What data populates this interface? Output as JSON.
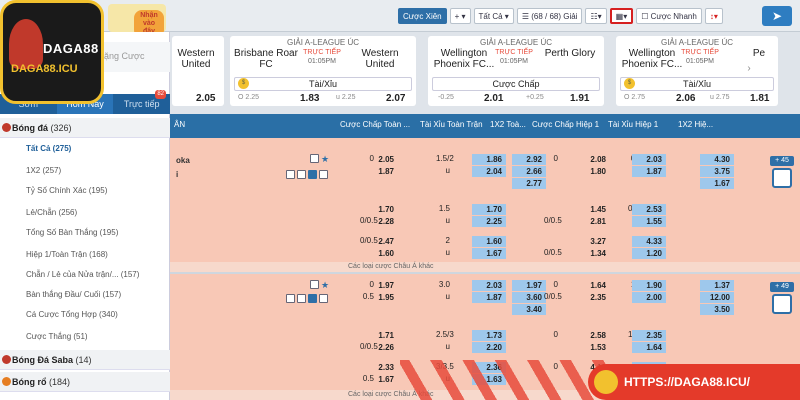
{
  "logo": {
    "text1": "DAGA88",
    "text2": "DAGA88.ICU"
  },
  "promo": {
    "badge": "Nhận vào đây"
  },
  "toolbar": {
    "parlay": "Cược Xiên",
    "all": "Tất Cả",
    "games": "(68 / 68) Giải",
    "quick": "Cược Nhanh"
  },
  "sidebar": {
    "search_placeholder": "ặng Cược",
    "tabs": [
      {
        "label": "Sớm"
      },
      {
        "label": "Hôm Nay"
      },
      {
        "label": "Trực tiếp",
        "badge": "82"
      }
    ],
    "sports": [
      {
        "label": "Bóng đá",
        "count": "(326)"
      },
      {
        "label": "Bóng Đá Saba",
        "count": "(14)"
      },
      {
        "label": "Bóng rổ",
        "count": "(184)"
      }
    ],
    "items": [
      {
        "label": "Tất Cả (275)"
      },
      {
        "label": "1X2 (257)"
      },
      {
        "label": "Tỷ Số Chính Xác (195)"
      },
      {
        "label": "Lẻ/Chẵn (256)"
      },
      {
        "label": "Tổng Số Bàn Thắng (195)"
      },
      {
        "label": "Hiệp 1/Toàn Trận (168)"
      },
      {
        "label": "Chẵn / Lẻ của Nửa trận/... (157)"
      },
      {
        "label": "Bàn thắng Đầu/ Cuối (157)"
      },
      {
        "label": "Cá Cược Tổng Hợp (340)"
      },
      {
        "label": "Cược Thắng (51)"
      }
    ]
  },
  "cards": [
    {
      "league": "",
      "home": "",
      "away": "Western United",
      "live": "",
      "time": "",
      "market": "",
      "ol": "",
      "ov1": "",
      "or": "",
      "ov2": "2.05"
    },
    {
      "league": "GIẢI A-LEAGUE ÚC",
      "home": "Brisbane Roar FC",
      "away": "Western United",
      "live": "TRỰC TIẾP",
      "time": "01:05PM",
      "market": "Tài/Xỉu",
      "ol": "O 2.25",
      "ov1": "1.83",
      "or": "u 2.25",
      "ov2": "2.07"
    },
    {
      "league": "GIẢI A-LEAGUE ÚC",
      "home": "Wellington Phoenix FC...",
      "away": "Perth Glory",
      "live": "TRỰC TIẾP",
      "time": "01:05PM",
      "market": "Cược Chấp",
      "ol": "-0.25",
      "ov1": "2.01",
      "or": "+0.25",
      "ov2": "1.91"
    },
    {
      "league": "GIẢI A-LEAGUE ÚC",
      "home": "Wellington Phoenix FC...",
      "away": "Pe",
      "live": "TRỰC TIẾP",
      "time": "01:05PM",
      "market": "Tài/Xỉu",
      "ol": "O 2.75",
      "ov1": "2.06",
      "or": "u 2.75",
      "ov2": "1.81"
    }
  ],
  "columns": [
    "ÂN",
    "Cược Chấp Toàn ...",
    "Tài Xỉu Toàn Trận",
    "1X2 Toà...",
    "Cược Chấp Hiệp 1",
    "Tài Xỉu Hiệp 1",
    "1X2 Hiệ..."
  ],
  "match1": {
    "team1": "oka",
    "team2": "i",
    "more": "+ 45",
    "rows": [
      [
        "0",
        "2.05",
        "1.5/2",
        "1.86",
        "2.92",
        "0",
        "2.08",
        "0.5",
        "2.03",
        "4.30"
      ],
      [
        "",
        "1.87",
        "u",
        "2.04",
        "2.66",
        "",
        "1.80",
        "u",
        "1.87",
        "3.75"
      ],
      [
        "",
        "",
        "",
        "",
        "2.77",
        "",
        "",
        "",
        "",
        "1.67"
      ],
      [
        "",
        "1.70",
        "1.5",
        "1.70",
        "",
        "",
        "1.45",
        "0.5/1",
        "2.53",
        ""
      ],
      [
        "0/0.5",
        "2.28",
        "u",
        "2.25",
        "",
        "0/0.5",
        "2.81",
        "u",
        "1.55",
        ""
      ],
      [
        "0/0.5",
        "2.47",
        "2",
        "1.60",
        "",
        "",
        "3.27",
        "1",
        "4.33",
        ""
      ],
      [
        "",
        "1.60",
        "u",
        "1.67",
        "",
        "0/0.5",
        "1.34",
        "u",
        "1.20",
        ""
      ]
    ]
  },
  "other_bets": "Các loại cược Châu Á khác",
  "match2": {
    "more": "+ 49",
    "rows": [
      [
        "0",
        "1.97",
        "3.0",
        "2.03",
        "1.97",
        "0",
        "1.64",
        "1.5",
        "1.90",
        "1.37"
      ],
      [
        "0.5",
        "1.95",
        "u",
        "1.87",
        "3.60",
        "0/0.5",
        "2.35",
        "u",
        "2.00",
        "12.00"
      ],
      [
        "",
        "",
        "",
        "",
        "3.40",
        "",
        "",
        "",
        "",
        "3.50"
      ],
      [
        "",
        "1.71",
        "2.5/3",
        "1.73",
        "",
        "0",
        "2.58",
        "1.5/2",
        "2.35",
        ""
      ],
      [
        "0/0.5",
        "2.26",
        "u",
        "2.20",
        "",
        "",
        "1.53",
        "u",
        "1.64",
        ""
      ],
      [
        "",
        "2.33",
        "3/3.5",
        "2.36",
        "",
        "0",
        "4.12",
        "2",
        "3.77",
        ""
      ],
      [
        "0.5",
        "1.67",
        "u",
        "1.63",
        "",
        "",
        "1.23",
        "u",
        "",
        ""
      ]
    ]
  },
  "site_url": "HTTPS://DAGA88.ICU/"
}
